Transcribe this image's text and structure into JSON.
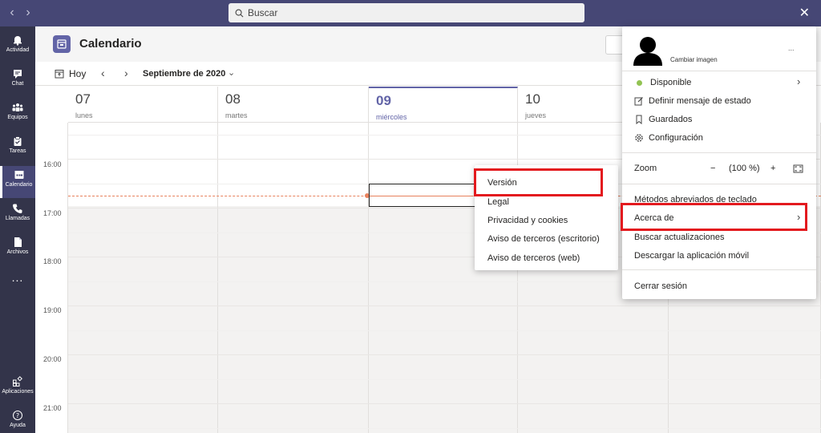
{
  "titlebar": {
    "back_icon": "chevron-left-icon",
    "forward_icon": "chevron-right-icon",
    "search_placeholder": "Buscar",
    "close_icon": "close-icon",
    "bg_color": "#464775"
  },
  "rail": {
    "items": [
      {
        "label": "Actividad",
        "icon": "bell-icon"
      },
      {
        "label": "Chat",
        "icon": "chat-icon"
      },
      {
        "label": "Equipos",
        "icon": "teams-icon"
      },
      {
        "label": "Tareas",
        "icon": "tasks-icon"
      },
      {
        "label": "Calendario",
        "icon": "calendar-icon"
      },
      {
        "label": "Llamadas",
        "icon": "phone-icon"
      },
      {
        "label": "Archivos",
        "icon": "file-icon"
      }
    ],
    "more": "...",
    "bottom": [
      {
        "label": "Aplicaciones",
        "icon": "apps-icon"
      },
      {
        "label": "Ayuda",
        "icon": "help-icon"
      }
    ]
  },
  "header": {
    "title": "Calendario",
    "accent_color": "#6264a7"
  },
  "toolbar": {
    "today_label": "Hoy",
    "month_label": "Septiembre de 2020"
  },
  "days": [
    {
      "num": "07",
      "name": "lunes"
    },
    {
      "num": "08",
      "name": "martes"
    },
    {
      "num": "09",
      "name": "miércoles"
    },
    {
      "num": "10",
      "name": "jueves"
    }
  ],
  "hours": [
    "16:00",
    "17:00",
    "18:00",
    "19:00",
    "20:00",
    "21:00"
  ],
  "submenu": {
    "items": [
      "Versión",
      "Legal",
      "Privacidad y cookies",
      "Aviso de terceros (escritorio)",
      "Aviso de terceros (web)"
    ]
  },
  "profile_menu": {
    "change_image": "Cambiar imagen",
    "more": "...",
    "status": "Disponible",
    "status_color": "#92c353",
    "set_status_message": "Definir mensaje de estado",
    "saved": "Guardados",
    "settings": "Configuración",
    "zoom_label": "Zoom",
    "zoom_minus": "−",
    "zoom_value": "(100 %)",
    "zoom_plus": "+",
    "shortcuts": "Métodos abreviados de teclado",
    "about": "Acerca de",
    "check_updates": "Buscar actualizaciones",
    "download_mobile": "Descargar la aplicación móvil",
    "sign_out": "Cerrar sesión"
  },
  "highlight_color": "#e3191e"
}
